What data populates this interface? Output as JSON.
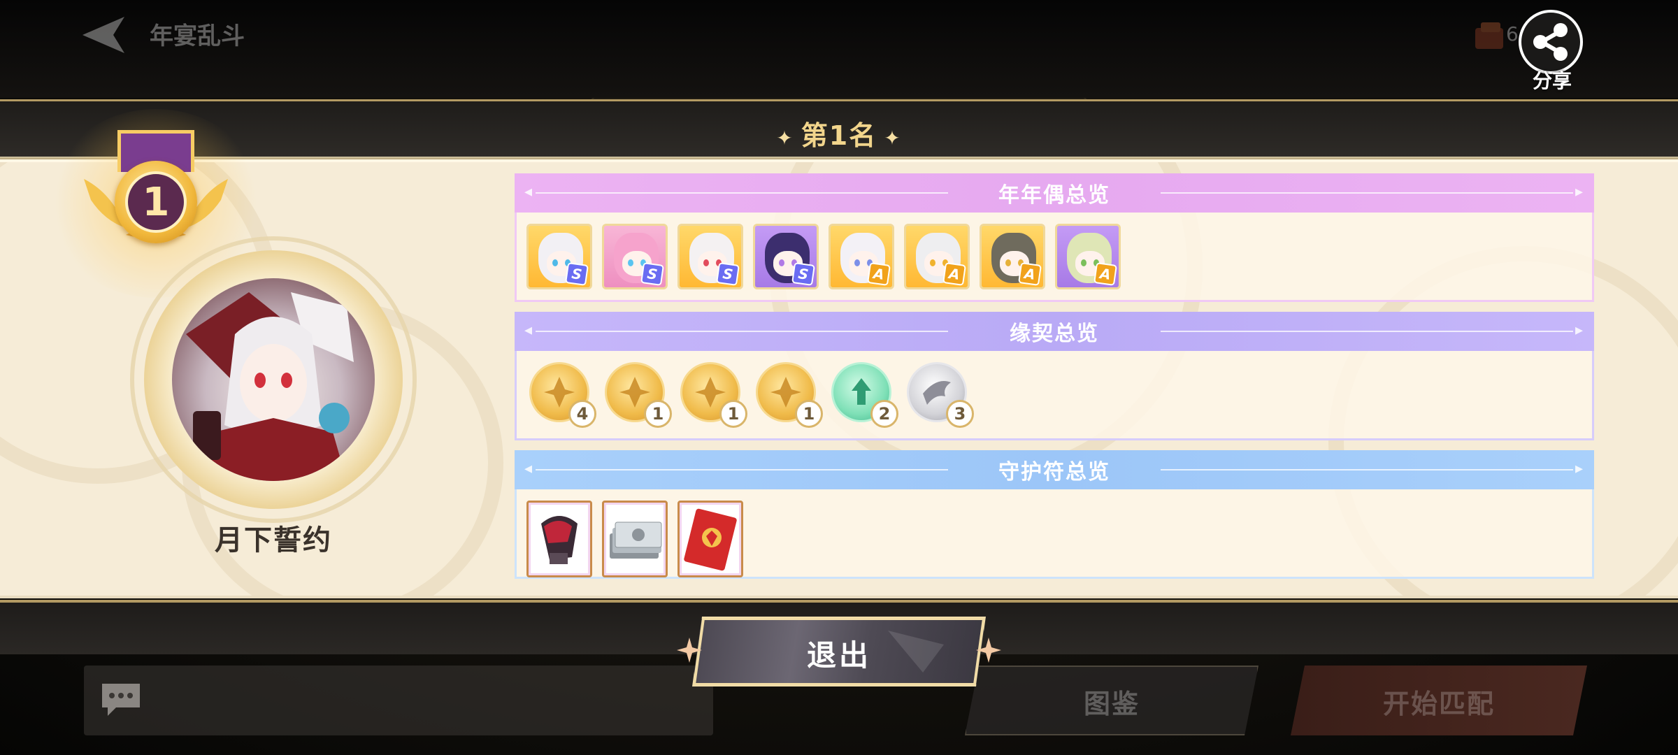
{
  "header": {
    "title": "年宴乱斗",
    "currency_value": "6",
    "share_label": "分享"
  },
  "rank": {
    "label": "第1名",
    "medal_number": "1"
  },
  "player": {
    "name": "月下誓约"
  },
  "sections": {
    "dolls": {
      "title": "年年偶总览",
      "items": [
        {
          "name": "doll-1",
          "grade": "S",
          "bg": "gold",
          "hair": "#f2f0f4",
          "eye": "#4fb9e8"
        },
        {
          "name": "doll-2",
          "grade": "S",
          "bg": "pink",
          "hair": "#f6a3cc",
          "eye": "#5ac4f0"
        },
        {
          "name": "doll-3",
          "grade": "S",
          "bg": "gold",
          "hair": "#f4f1f2",
          "eye": "#e24b5c"
        },
        {
          "name": "doll-4",
          "grade": "S",
          "bg": "purple",
          "hair": "#3c2e6e",
          "eye": "#b07ae6"
        },
        {
          "name": "doll-5",
          "grade": "A",
          "bg": "gold",
          "hair": "#f3f1f6",
          "eye": "#7c8fe8"
        },
        {
          "name": "doll-6",
          "grade": "A",
          "bg": "gold",
          "hair": "#eeeef0",
          "eye": "#f0b22e"
        },
        {
          "name": "doll-7",
          "grade": "A",
          "bg": "gold",
          "hair": "#6f6b5d",
          "eye": "#e6b13a"
        },
        {
          "name": "doll-8",
          "grade": "A",
          "bg": "purple",
          "hair": "#dfe6b6",
          "eye": "#7bbf5c"
        }
      ]
    },
    "bonds": {
      "title": "缘契总览",
      "items": [
        {
          "name": "bond-1",
          "count": "4",
          "style": "gold"
        },
        {
          "name": "bond-2",
          "count": "1",
          "style": "gold"
        },
        {
          "name": "bond-3",
          "count": "1",
          "style": "gold"
        },
        {
          "name": "bond-4",
          "count": "1",
          "style": "gold"
        },
        {
          "name": "bond-5",
          "count": "2",
          "style": "teal"
        },
        {
          "name": "bond-6",
          "count": "3",
          "style": "silver"
        }
      ]
    },
    "charms": {
      "title": "守护符总览",
      "items": [
        {
          "name": "charm-gauntlet"
        },
        {
          "name": "charm-banknotes"
        },
        {
          "name": "charm-red-envelope"
        }
      ]
    }
  },
  "footer": {
    "exit_label": "退出",
    "gallery_label": "图鉴",
    "match_label": "开始匹配"
  }
}
